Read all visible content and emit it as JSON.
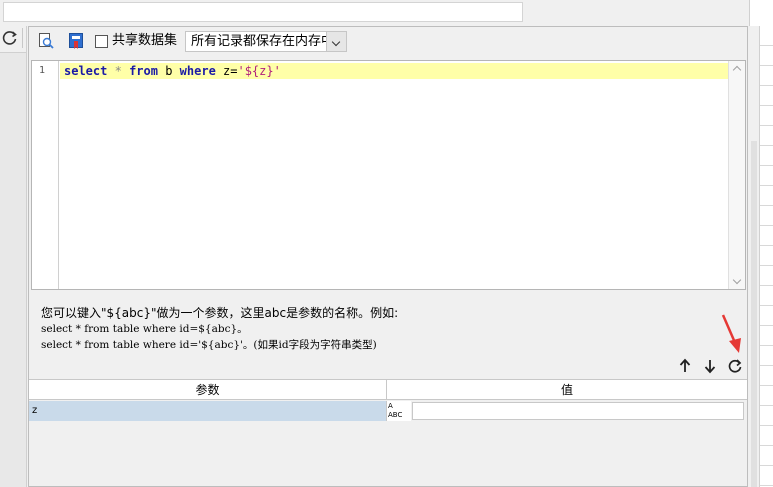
{
  "toolbar": {
    "share_label": "共享数据集",
    "share_checked": false,
    "memory_option": "所有记录都保存在内存中"
  },
  "editor": {
    "line_number": "1",
    "sql": {
      "kw_select": "select",
      "star": "*",
      "kw_from": "from",
      "table": "b",
      "kw_where": "where",
      "field": "z=",
      "value": "'${z}'"
    }
  },
  "help": {
    "line1": "您可以键入\"${abc}\"做为一个参数，这里abc是参数的名称。例如:",
    "line2": "select * from table where id=${abc}。",
    "line3": "select * from table where id='${abc}'。(如果id字段为字符串类型)"
  },
  "params_table": {
    "headers": [
      "参数",
      "值"
    ],
    "rows": [
      {
        "name": "z",
        "type_top": "A",
        "type_bottom": "ABC",
        "value": ""
      }
    ]
  },
  "icons": {
    "refresh": "refresh-icon",
    "preview": "preview-icon",
    "bookmark": "bookmark-icon",
    "up": "arrow-up-icon",
    "down": "arrow-down-icon",
    "refresh_params": "refresh-icon"
  },
  "colors": {
    "highlight_line": "#ffffa8",
    "selected_row": "#c9daea",
    "keyword": "#1a1aa6",
    "string": "#b0207c",
    "annotation_arrow": "#e53935"
  }
}
